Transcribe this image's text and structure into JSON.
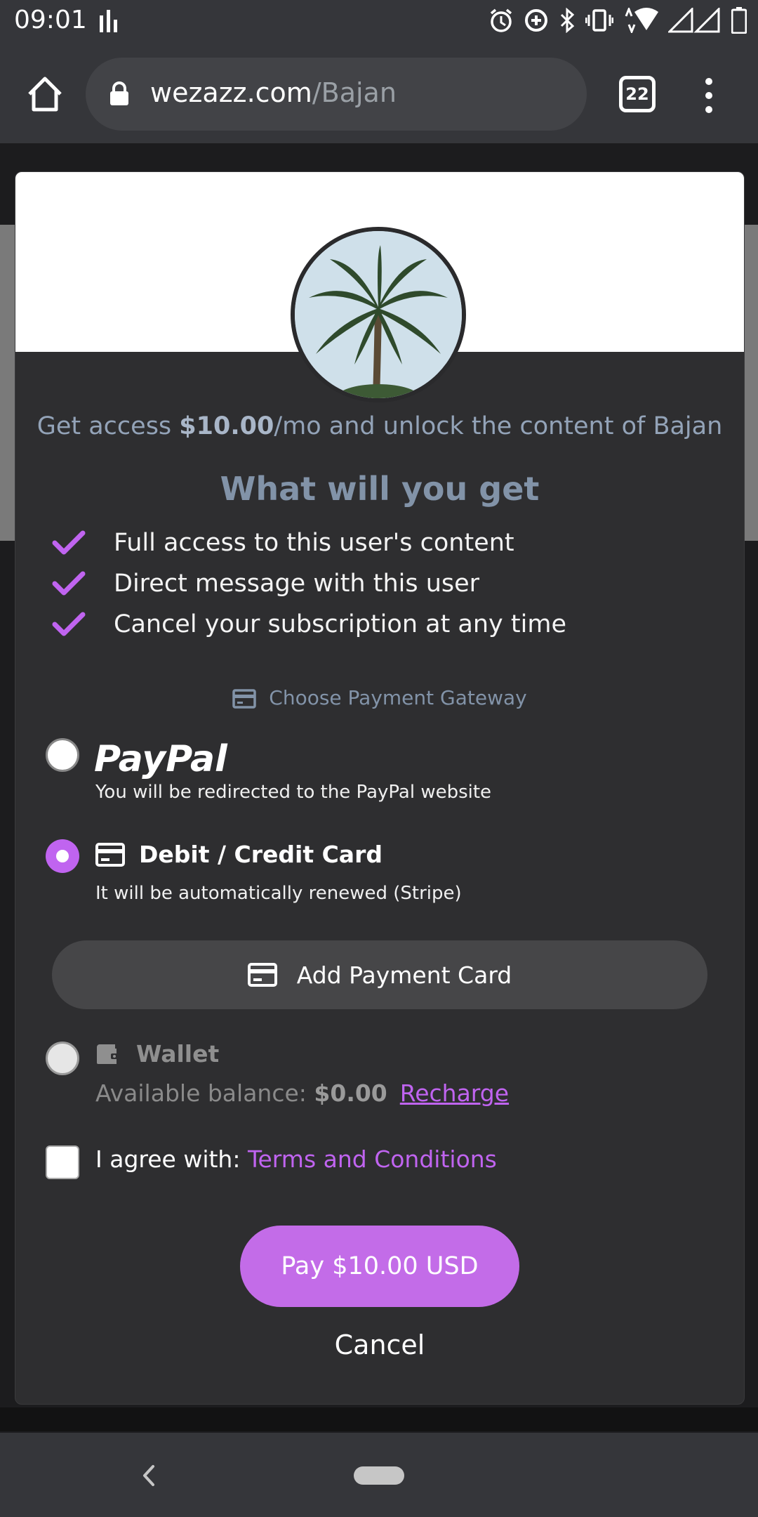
{
  "status_bar": {
    "time": "09:01"
  },
  "browser": {
    "url_domain": "wezazz.com",
    "url_path": "/Bajan",
    "tab_count": "22"
  },
  "modal": {
    "access_prefix": "Get access ",
    "access_price": "$10.00",
    "access_suffix": "/mo and unlock the content of Bajan",
    "what_title": "What will you get",
    "benefits": [
      "Full access to this user's content",
      "Direct message with this user",
      "Cancel your subscription at any time"
    ],
    "gateway_title": "Choose Payment Gateway",
    "paypal": {
      "label": "PayPal",
      "description": "You will be redirected to the PayPal website"
    },
    "card": {
      "label": "Debit / Credit Card",
      "description": "It will be automatically renewed (Stripe)"
    },
    "add_card_label": "Add Payment Card",
    "wallet": {
      "label": "Wallet",
      "balance_label": "Available balance: ",
      "balance_value": "$0.00",
      "recharge_label": "Recharge"
    },
    "agree_label": "I agree with: ",
    "terms_label": "Terms and Conditions",
    "pay_label": "Pay $10.00 USD",
    "cancel_label": "Cancel",
    "selected_gateway": "card"
  },
  "colors": {
    "accent": "#c064f0",
    "modal_bg": "#2e2e30",
    "muted_title": "#8293a8"
  },
  "icons": {
    "status_left": "bar-chart-icon",
    "status_right": [
      "alarm-icon",
      "data-saver-icon",
      "bluetooth-icon",
      "vibrate-icon",
      "wifi-icon",
      "signal-icon",
      "battery-icon"
    ],
    "gateway": "credit-card-icon",
    "wallet": "wallet-icon",
    "check": "check-icon"
  }
}
